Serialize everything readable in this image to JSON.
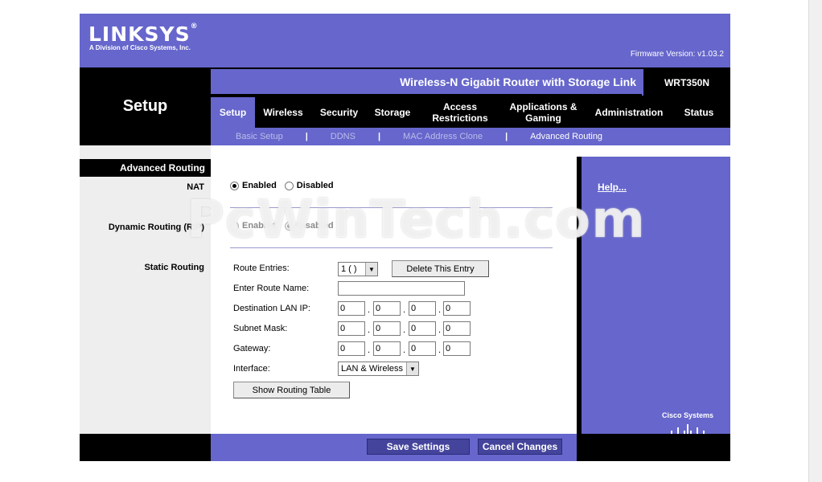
{
  "header": {
    "logo": "LINKSYS",
    "logo_reg": "®",
    "logo_sub": "A Division of Cisco Systems, Inc.",
    "firmware": "Firmware Version: v1.03.2",
    "product_name": "Wireless-N Gigabit Router with Storage Link",
    "model": "WRT350N",
    "section": "Setup"
  },
  "tabs": [
    {
      "label": "Setup",
      "active": true
    },
    {
      "label": "Wireless"
    },
    {
      "label": "Security"
    },
    {
      "label": "Storage"
    },
    {
      "label": "Access Restrictions"
    },
    {
      "label": "Applications & Gaming"
    },
    {
      "label": "Administration"
    },
    {
      "label": "Status"
    }
  ],
  "subnav": {
    "items": [
      "Basic Setup",
      "DDNS",
      "MAC Address Clone",
      "Advanced Routing"
    ],
    "separator": "|",
    "current": "Advanced Routing"
  },
  "left": {
    "section_header": "Advanced Routing",
    "nat": "NAT",
    "rip": "Dynamic Routing (RIP)",
    "static": "Static Routing"
  },
  "nat": {
    "enabled": "Enabled",
    "disabled": "Disabled",
    "selected": "Enabled"
  },
  "rip": {
    "enabled": "Enabled",
    "disabled": "Disabled",
    "selected": "Disabled",
    "state": "disabled"
  },
  "static": {
    "route_entries_label": "Route Entries:",
    "route_entries_value": "1 ( )",
    "delete_button": "Delete This Entry",
    "route_name_label": "Enter Route Name:",
    "route_name_value": "",
    "dest_ip_label": "Destination LAN IP:",
    "dest_ip": [
      "0",
      "0",
      "0",
      "0"
    ],
    "subnet_label": "Subnet Mask:",
    "subnet": [
      "0",
      "0",
      "0",
      "0"
    ],
    "gateway_label": "Gateway:",
    "gateway": [
      "0",
      "0",
      "0",
      "0"
    ],
    "interface_label": "Interface:",
    "interface_value": "LAN & Wireless",
    "show_table_button": "Show Routing Table",
    "dot": "."
  },
  "help": {
    "link": "Help..."
  },
  "footer": {
    "save": "Save Settings",
    "cancel": "Cancel Changes",
    "cisco": "Cisco Systems"
  },
  "watermark": "PcWinTech.com",
  "colors": {
    "brand_purple": "#6666cc",
    "button_blue": "#44449c",
    "black": "#000000"
  }
}
